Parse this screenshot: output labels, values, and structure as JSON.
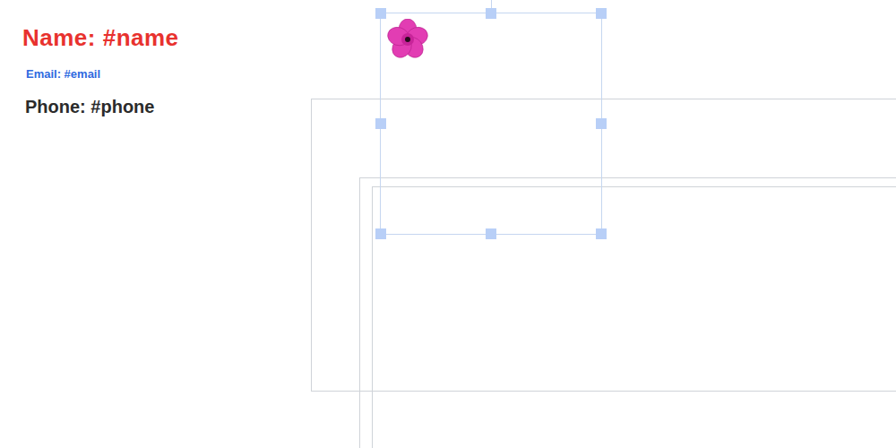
{
  "canvas": {
    "texts": [
      {
        "text": "Name: #name",
        "color": "#e8322e",
        "kind": "name"
      },
      {
        "text": "Email: #email",
        "color": "#2f6ae0",
        "kind": "email"
      },
      {
        "text": "Phone: #phone",
        "color": "#2b2b2b",
        "kind": "phone"
      }
    ],
    "shapes": [
      {
        "kind": "rectangle",
        "selected": false
      },
      {
        "kind": "rectangle",
        "selected": false
      },
      {
        "kind": "rectangle",
        "selected": false
      },
      {
        "kind": "image",
        "selected": true
      }
    ]
  }
}
